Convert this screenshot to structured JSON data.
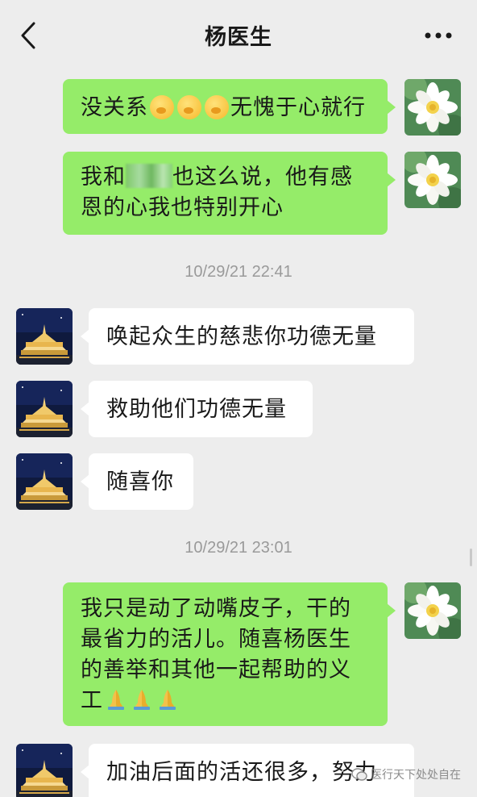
{
  "header": {
    "title": "杨医生",
    "back_icon": "chevron-left-icon",
    "more_icon": "more-dots-icon"
  },
  "messages": [
    {
      "direction": "out",
      "text_before": "没关系",
      "emoji": "facepalm-emoji",
      "emoji_count": 3,
      "text_after": "无愧于心就行"
    },
    {
      "direction": "out",
      "line1_a": "我和",
      "line1_b": "也这么说，他有感",
      "line2": "恩的心我也特别开心",
      "redacted": true
    },
    {
      "direction": "in",
      "text": "唤起众生的慈悲你功德无量"
    },
    {
      "direction": "in",
      "text": "救助他们功德无量"
    },
    {
      "direction": "in",
      "text": "随喜你"
    },
    {
      "direction": "out",
      "lines": [
        "我只是动了动嘴皮子，干的",
        "最省力的活儿。随喜杨医生",
        "的善举和其他一起帮助的义",
        "工"
      ],
      "emoji": "folded-hands-emoji",
      "emoji_count": 3
    },
    {
      "direction": "in",
      "text": "加油后面的活还很多，努力"
    }
  ],
  "timestamps": [
    "10/29/21 22:41",
    "10/29/21 23:01"
  ],
  "watermark": "医行天下处处自在",
  "colors": {
    "background": "#ededed",
    "outgoing_bubble": "#95ec69",
    "incoming_bubble": "#ffffff",
    "timestamp": "#9a9a9a"
  }
}
